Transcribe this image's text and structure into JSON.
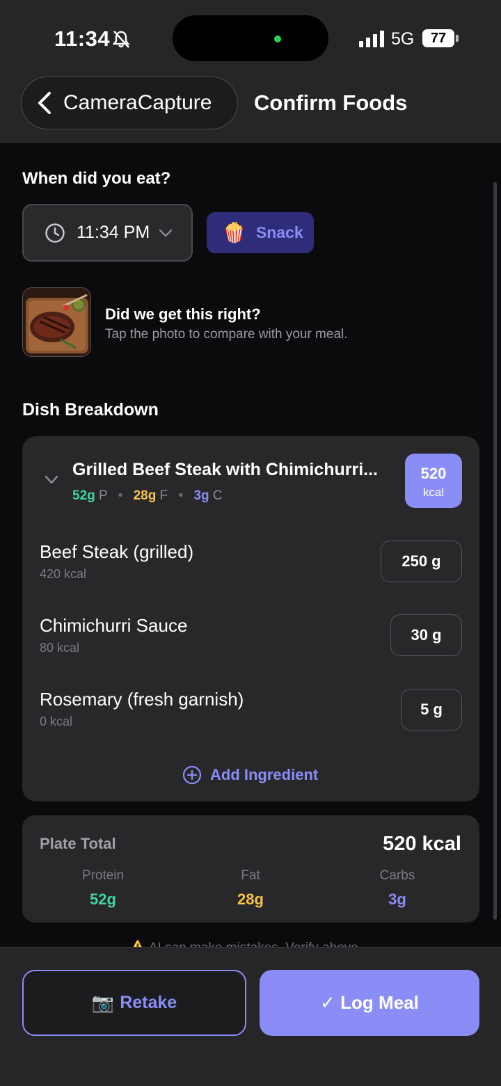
{
  "status_bar": {
    "time": "11:34",
    "network": "5G",
    "battery": "77"
  },
  "nav": {
    "back_label": "CameraCapture",
    "title": "Confirm Foods"
  },
  "meal_time": {
    "question": "When did you eat?",
    "time_value": "11:34 PM",
    "meal_type": "Snack",
    "meal_type_emoji": "🍿"
  },
  "photo_check": {
    "title": "Did we get this right?",
    "subtitle": "Tap the photo to compare with your meal."
  },
  "breakdown": {
    "title": "Dish Breakdown",
    "dish": {
      "name": "Grilled Beef Steak with Chimichurri...",
      "protein": "52g",
      "protein_letter": "P",
      "fat": "28g",
      "fat_letter": "F",
      "carbs": "3g",
      "carbs_letter": "C",
      "kcal": "520",
      "kcal_unit": "kcal"
    },
    "ingredients": [
      {
        "name": "Beef Steak (grilled)",
        "kcal": "420 kcal",
        "qty": "250 g"
      },
      {
        "name": "Chimichurri Sauce",
        "kcal": "80 kcal",
        "qty": "30 g"
      },
      {
        "name": "Rosemary (fresh garnish)",
        "kcal": "0 kcal",
        "qty": "5 g"
      }
    ],
    "add_label": "Add Ingredient"
  },
  "plate_total": {
    "label": "Plate Total",
    "kcal": "520 kcal",
    "protein_label": "Protein",
    "protein": "52g",
    "fat_label": "Fat",
    "fat": "28g",
    "carbs_label": "Carbs",
    "carbs": "3g"
  },
  "warning": "⚠️ AI can make mistakes. Verify above.",
  "actions": {
    "retake_emoji": "📷",
    "retake": "Retake",
    "log": "✓ Log Meal"
  },
  "colors": {
    "accent": "#8a8df5",
    "protein": "#3fd6a0",
    "fat": "#f5c24a",
    "carbs": "#8a8df5",
    "snack_bg": "#2f2d7a"
  }
}
